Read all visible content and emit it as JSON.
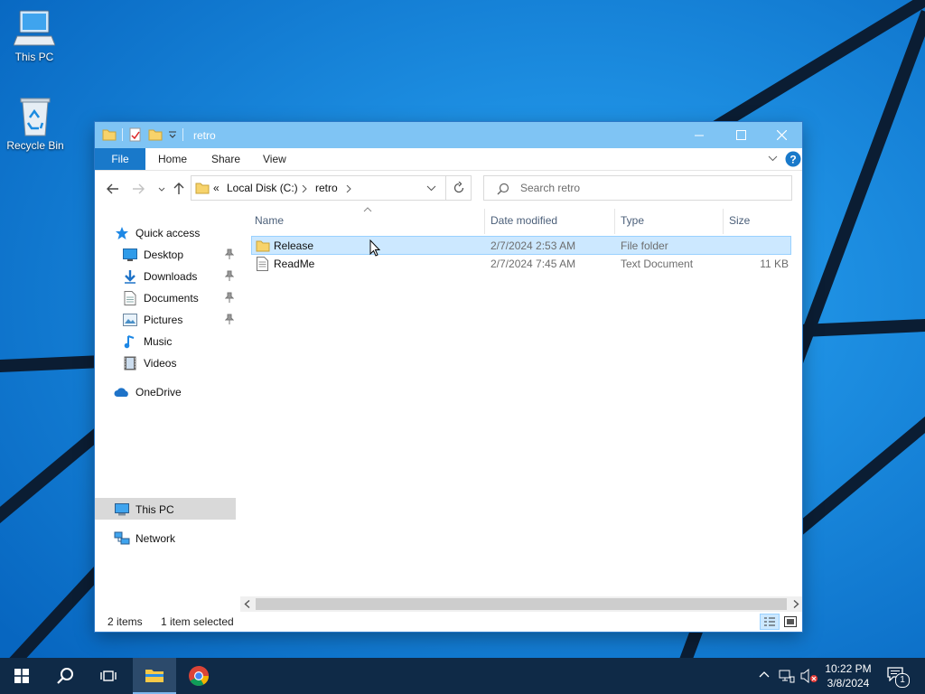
{
  "desktop": {
    "icons": [
      {
        "label": "This PC",
        "icon": "computer-icon"
      },
      {
        "label": "Recycle Bin",
        "icon": "recycle-bin-icon"
      }
    ]
  },
  "window": {
    "title": "retro",
    "ribbon_tabs": [
      "File",
      "Home",
      "Share",
      "View"
    ],
    "address": {
      "prefix": "«",
      "crumbs": [
        "Local Disk (C:)",
        "retro"
      ]
    },
    "search_placeholder": "Search retro",
    "nav": {
      "quick_access": "Quick access",
      "items": [
        "Desktop",
        "Downloads",
        "Documents",
        "Pictures",
        "Music",
        "Videos"
      ],
      "onedrive": "OneDrive",
      "this_pc": "This PC",
      "network": "Network"
    },
    "columns": {
      "name": "Name",
      "date": "Date modified",
      "type": "Type",
      "size": "Size"
    },
    "files": [
      {
        "name": "Release",
        "date": "2/7/2024 2:53 AM",
        "type": "File folder",
        "size": "",
        "selected": true
      },
      {
        "name": "ReadMe",
        "date": "2/7/2024 7:45 AM",
        "type": "Text Document",
        "size": "11 KB",
        "selected": false
      }
    ],
    "status": {
      "items": "2 items",
      "selected": "1 item selected"
    }
  },
  "taskbar": {
    "time": "10:22 PM",
    "date": "3/8/2024",
    "notification_count": "1"
  },
  "colors": {
    "accent": "#1979ca",
    "selection": "#cce8ff",
    "titlebar": "#7fc4f4",
    "taskbar": "#0f2a47"
  }
}
